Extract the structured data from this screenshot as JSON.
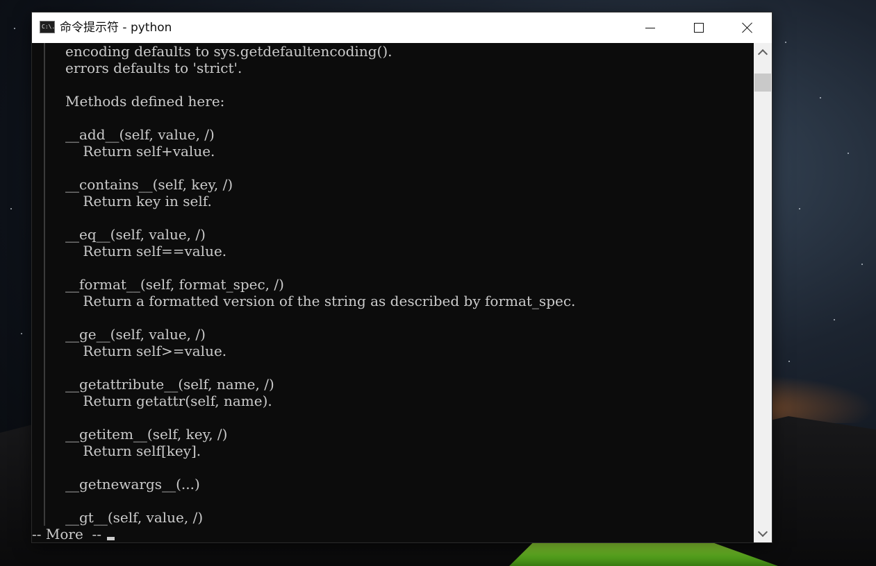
{
  "window": {
    "title": "命令提示符 - python",
    "icon_text": "C:\\."
  },
  "console": {
    "lines": [
      "encoding defaults to sys.getdefaultencoding().",
      "errors defaults to 'strict'.",
      "",
      "Methods defined here:",
      "",
      "__add__(self, value, /)",
      "    Return self+value.",
      "",
      "__contains__(self, key, /)",
      "    Return key in self.",
      "",
      "__eq__(self, value, /)",
      "    Return self==value.",
      "",
      "__format__(self, format_spec, /)",
      "    Return a formatted version of the string as described by format_spec.",
      "",
      "__ge__(self, value, /)",
      "    Return self>=value.",
      "",
      "__getattribute__(self, name, /)",
      "    Return getattr(self, name).",
      "",
      "__getitem__(self, key, /)",
      "    Return self[key].",
      "",
      "__getnewargs__(...)",
      "",
      "__gt__(self, value, /)"
    ],
    "more_prompt": "-- More  --"
  },
  "icons": {
    "minimize": "minimize-icon",
    "maximize": "maximize-icon",
    "close": "close-icon",
    "scroll_up": "chevron-up-icon",
    "scroll_down": "chevron-down-icon"
  },
  "colors": {
    "console_bg": "#0c0c0c",
    "console_fg": "#cccccc",
    "titlebar_bg": "#ffffff"
  }
}
